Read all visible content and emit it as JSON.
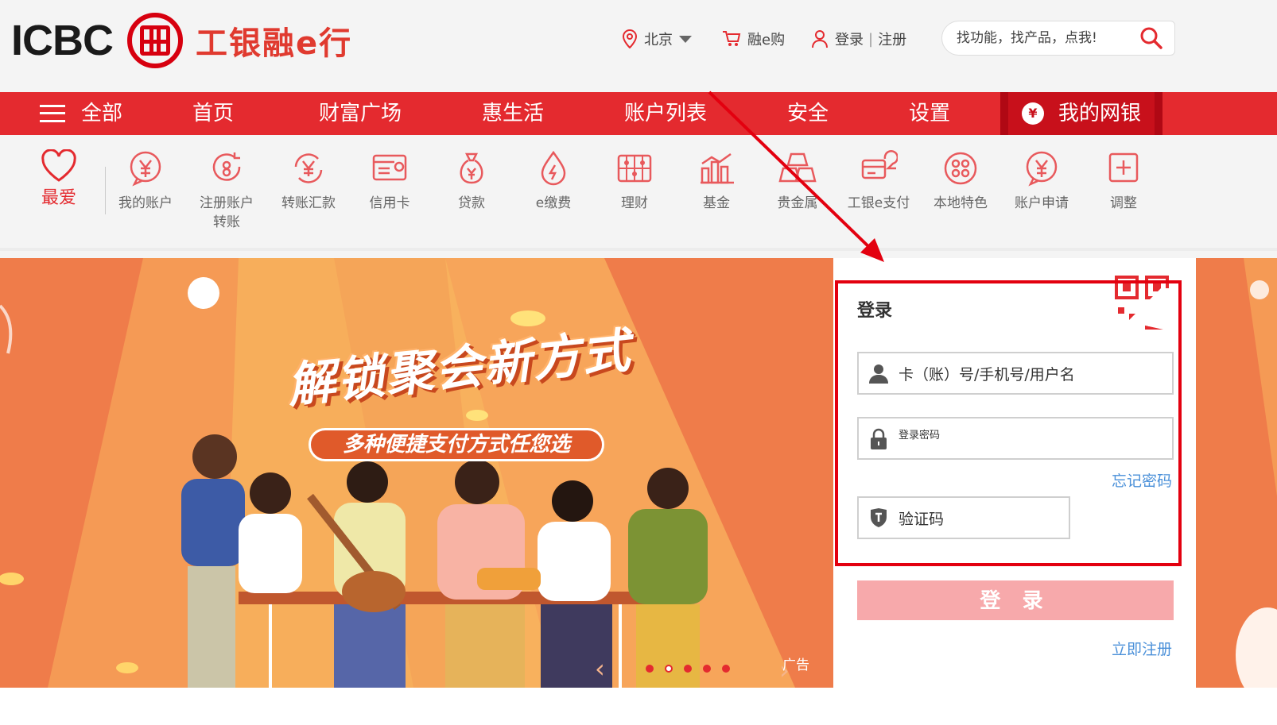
{
  "header": {
    "logo_text": "ICBC",
    "logo_cn": "工银融e行",
    "location": "北京",
    "shop": "融e购",
    "login": "登录",
    "separator": "|",
    "register": "注册",
    "search_placeholder": "找功能，找产品，点我!"
  },
  "nav": {
    "items": [
      "全部",
      "首页",
      "财富广场",
      "惠生活",
      "账户列表",
      "安全",
      "设置",
      "我的网银"
    ],
    "accent": "#e42a2f"
  },
  "quick": {
    "favorites": "最爱",
    "items": [
      {
        "line1": "我的账户",
        "line2": ""
      },
      {
        "line1": "注册账户",
        "line2": "转账"
      },
      {
        "line1": "转账汇款",
        "line2": ""
      },
      {
        "line1": "信用卡",
        "line2": ""
      },
      {
        "line1": "贷款",
        "line2": ""
      },
      {
        "line1": "e缴费",
        "line2": ""
      },
      {
        "line1": "理财",
        "line2": ""
      },
      {
        "line1": "基金",
        "line2": ""
      },
      {
        "line1": "贵金属",
        "line2": ""
      },
      {
        "line1": "工银e支付",
        "line2": ""
      },
      {
        "line1": "本地特色",
        "line2": ""
      },
      {
        "line1": "账户申请",
        "line2": ""
      },
      {
        "line1": "调整",
        "line2": ""
      }
    ]
  },
  "banner": {
    "title": "解锁聚会新方式",
    "subtitle": "多种便捷支付方式任您选",
    "ad": "广告",
    "slides_total": 5,
    "slide_current": 2
  },
  "login": {
    "title": "登录",
    "username_placeholder": "卡（账）号/手机号/用户名",
    "password_placeholder": "登录密码",
    "forgot": "忘记密码",
    "captcha_placeholder": "验证码",
    "button": "登 录",
    "register": "立即注册"
  }
}
